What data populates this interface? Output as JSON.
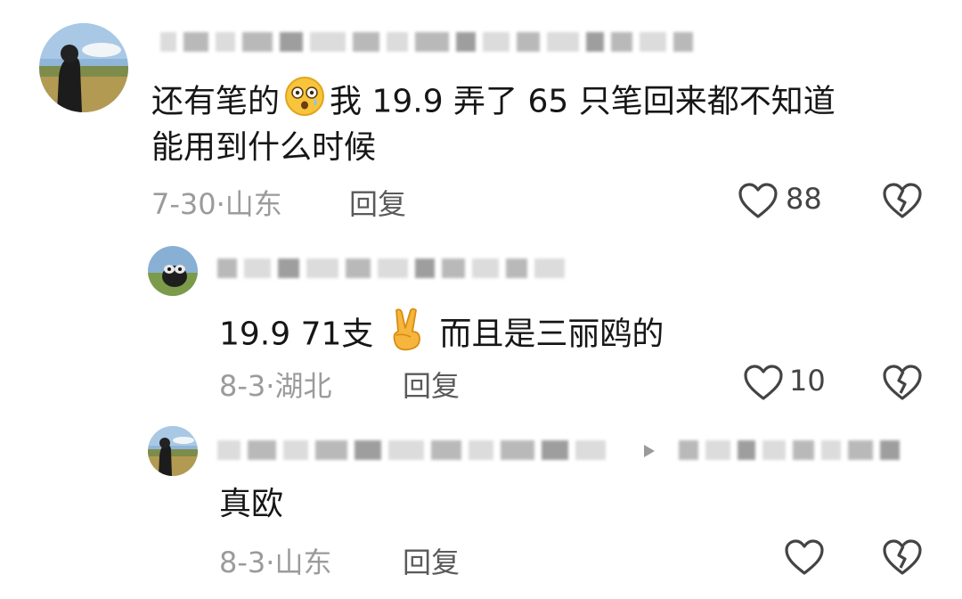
{
  "comments": [
    {
      "text_parts": [
        "还有笔的",
        "我 19.9 弄了 65 只笔回来都不知道"
      ],
      "text_line2": "能用到什么时候",
      "emoji_icon": "anguished-face-emoji-icon",
      "date": "7-30",
      "location": "山东",
      "reply_label": "回复",
      "likes": "88"
    },
    {
      "text_parts": [
        "19.9 71支",
        "而且是三丽鸥的"
      ],
      "emoji_icon": "victory-hand-emoji-icon",
      "date": "8-3",
      "location": "湖北",
      "reply_label": "回复",
      "likes": "10"
    },
    {
      "text": "真欧",
      "date": "8-3",
      "location": "山东",
      "reply_label": "回复",
      "likes": ""
    }
  ],
  "separator": "·",
  "colors": {
    "text": "#161616",
    "meta": "#9b9b9b",
    "icon": "#444444"
  }
}
